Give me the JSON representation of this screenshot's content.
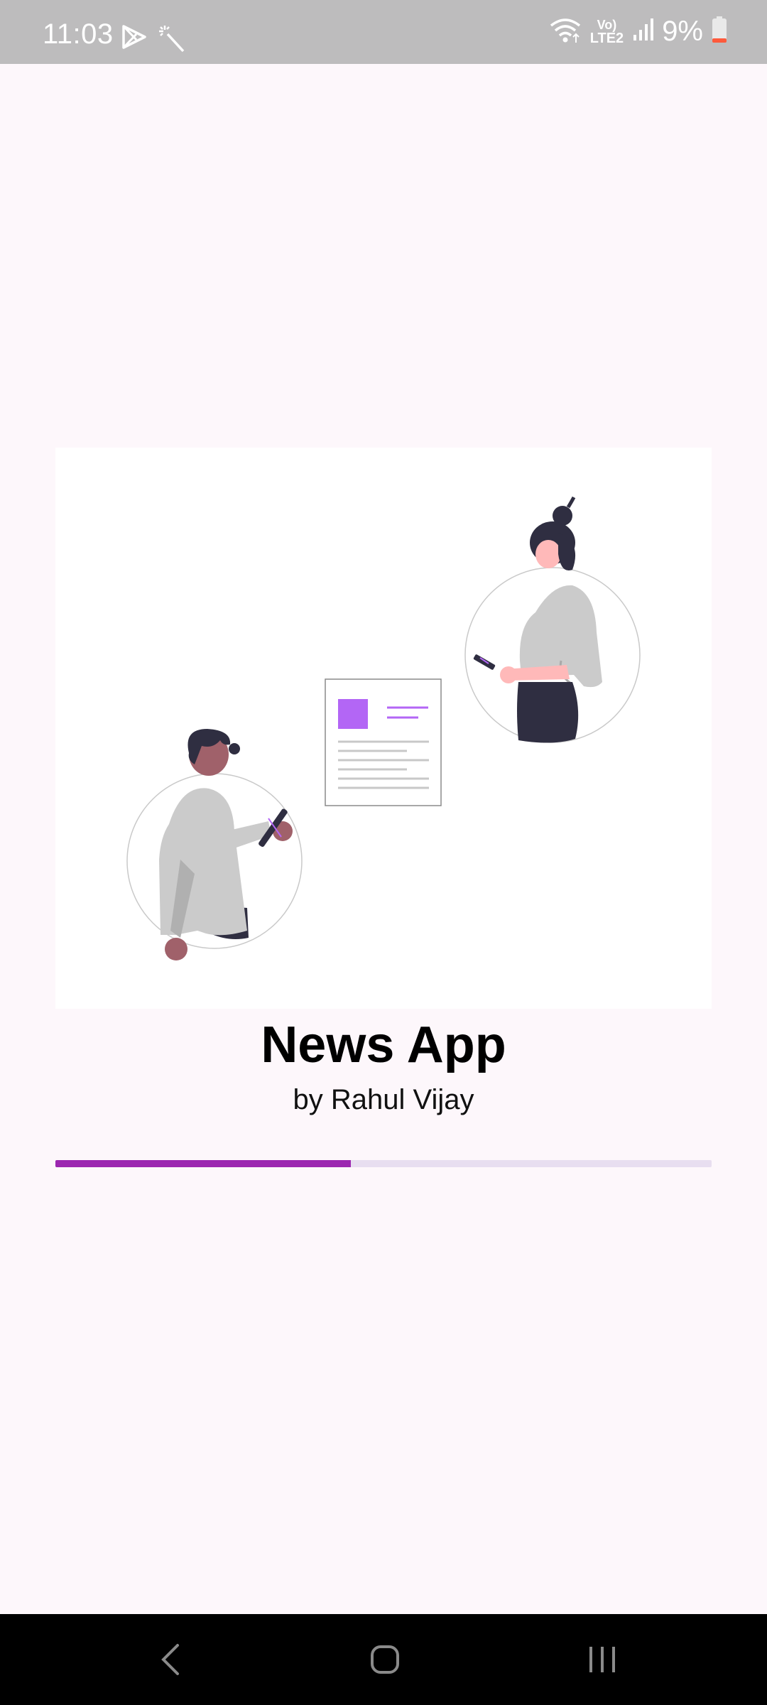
{
  "status_bar": {
    "time": "11:03",
    "left_icons": [
      "play-store-icon",
      "magic-wand-icon"
    ],
    "right_icons": [
      "wifi-icon",
      "volte-lte2-icon",
      "signal-icon",
      "battery-icon"
    ],
    "volte_label": "Vo)",
    "lte_label": "LTE2",
    "battery_percent": "9%"
  },
  "splash": {
    "title": "News App",
    "subtitle": "by Rahul Vijay",
    "progress": 0.45
  },
  "colors": {
    "accent": "#9c27b0",
    "illustration_accent": "#b366f5",
    "background": "#fdf7fb",
    "status_bar": "#bdbcbd"
  },
  "nav_bar": {
    "buttons": [
      "back-icon",
      "home-icon",
      "recents-icon"
    ]
  }
}
